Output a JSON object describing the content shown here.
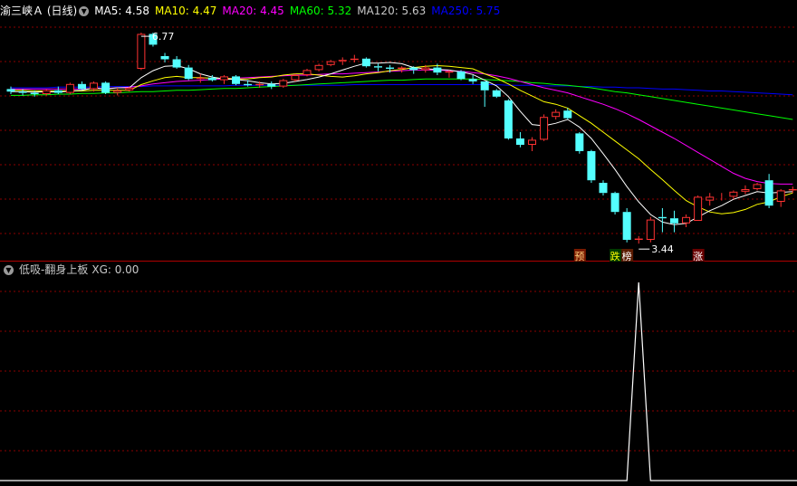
{
  "main_panel": {
    "title": "渝三峡Ａ (日线)",
    "ma_labels": [
      {
        "text": "MA5: 4.58",
        "color": "#ffffff"
      },
      {
        "text": "MA10: 4.47",
        "color": "#ffff00"
      },
      {
        "text": "MA20: 4.45",
        "color": "#ff00ff"
      },
      {
        "text": "MA60: 5.32",
        "color": "#00ff00"
      },
      {
        "text": "MA120: 5.63",
        "color": "#c8c8c8"
      },
      {
        "text": "MA250: 5.75",
        "color": "#0000ff"
      }
    ],
    "high_label": "6.77",
    "low_label": "3.44",
    "tags": [
      {
        "text": "预",
        "bg": "#7a1a00",
        "fg": "#ffd080",
        "bar": 48
      },
      {
        "text": "跌",
        "bg": "#003a00",
        "fg": "#ffff00",
        "bar": 51
      },
      {
        "text": "榜",
        "bg": "#5a1a00",
        "fg": "#ffffff",
        "bar": 52
      },
      {
        "text": "涨",
        "bg": "#6a0000",
        "fg": "#ffffff",
        "bar": 58
      }
    ]
  },
  "sub_panel": {
    "title": "低吸-翻身上板",
    "indicator_label": "XG: 0.00"
  },
  "colors": {
    "up": "#ff3232",
    "down": "#54ffff",
    "grid": "#8b0000",
    "ma5": "#ffffff",
    "ma10": "#ffff00",
    "ma20": "#ff00ff",
    "ma60": "#00ff00",
    "ma250": "#0000ff",
    "xg": "#ffffff"
  },
  "chart_data": [
    {
      "type": "candlestick",
      "ylim": [
        3.2,
        7.0
      ],
      "ohlc": [
        [
          5.88,
          5.92,
          5.8,
          5.84
        ],
        [
          5.84,
          5.88,
          5.78,
          5.82
        ],
        [
          5.82,
          5.86,
          5.76,
          5.8
        ],
        [
          5.8,
          5.88,
          5.78,
          5.86
        ],
        [
          5.86,
          5.92,
          5.8,
          5.82
        ],
        [
          5.82,
          5.98,
          5.8,
          5.96
        ],
        [
          5.96,
          6.0,
          5.86,
          5.88
        ],
        [
          5.88,
          6.0,
          5.84,
          5.98
        ],
        [
          5.98,
          6.0,
          5.8,
          5.82
        ],
        [
          5.82,
          5.9,
          5.78,
          5.86
        ],
        [
          5.86,
          5.92,
          5.84,
          5.9
        ],
        [
          6.2,
          6.77,
          6.18,
          6.75
        ],
        [
          6.75,
          6.77,
          6.55,
          6.58
        ],
        [
          6.4,
          6.45,
          6.3,
          6.35
        ],
        [
          6.35,
          6.4,
          6.2,
          6.22
        ],
        [
          6.22,
          6.26,
          6.02,
          6.04
        ],
        [
          6.04,
          6.12,
          5.98,
          6.06
        ],
        [
          6.06,
          6.1,
          6.0,
          6.02
        ],
        [
          6.02,
          6.1,
          5.96,
          6.08
        ],
        [
          6.08,
          6.1,
          5.94,
          5.96
        ],
        [
          5.96,
          6.02,
          5.92,
          5.94
        ],
        [
          5.94,
          6.0,
          5.9,
          5.96
        ],
        [
          5.96,
          6.0,
          5.88,
          5.92
        ],
        [
          5.92,
          6.04,
          5.9,
          6.02
        ],
        [
          6.02,
          6.12,
          6.0,
          6.1
        ],
        [
          6.1,
          6.2,
          6.08,
          6.18
        ],
        [
          6.18,
          6.28,
          6.16,
          6.26
        ],
        [
          6.26,
          6.34,
          6.24,
          6.32
        ],
        [
          6.32,
          6.38,
          6.26,
          6.34
        ],
        [
          6.34,
          6.42,
          6.3,
          6.36
        ],
        [
          6.36,
          6.38,
          6.22,
          6.24
        ],
        [
          6.24,
          6.28,
          6.16,
          6.22
        ],
        [
          6.22,
          6.26,
          6.14,
          6.2
        ],
        [
          6.2,
          6.24,
          6.14,
          6.22
        ],
        [
          6.22,
          6.24,
          6.12,
          6.18
        ],
        [
          6.18,
          6.26,
          6.14,
          6.22
        ],
        [
          6.22,
          6.28,
          6.1,
          6.14
        ],
        [
          6.14,
          6.18,
          6.06,
          6.16
        ],
        [
          6.16,
          6.18,
          6.02,
          6.04
        ],
        [
          6.04,
          6.1,
          5.96,
          6.0
        ],
        [
          6.0,
          6.0,
          5.6,
          5.86
        ],
        [
          5.86,
          5.88,
          5.74,
          5.76
        ],
        [
          5.7,
          5.72,
          5.08,
          5.1
        ],
        [
          5.1,
          5.2,
          4.96,
          5.0
        ],
        [
          5.0,
          5.12,
          4.9,
          5.08
        ],
        [
          5.08,
          5.48,
          5.06,
          5.44
        ],
        [
          5.44,
          5.56,
          5.4,
          5.52
        ],
        [
          5.54,
          5.58,
          5.4,
          5.42
        ],
        [
          5.18,
          5.2,
          4.86,
          4.9
        ],
        [
          4.9,
          4.92,
          4.4,
          4.44
        ],
        [
          4.4,
          4.44,
          4.2,
          4.24
        ],
        [
          4.24,
          4.26,
          3.9,
          3.94
        ],
        [
          3.94,
          4.0,
          3.46,
          3.5
        ],
        [
          3.5,
          3.56,
          3.44,
          3.52
        ],
        [
          3.5,
          3.86,
          3.46,
          3.82
        ],
        [
          3.86,
          4.0,
          3.62,
          3.84
        ],
        [
          3.84,
          3.96,
          3.62,
          3.76
        ],
        [
          3.76,
          3.9,
          3.7,
          3.86
        ],
        [
          3.8,
          4.2,
          3.8,
          4.18
        ],
        [
          4.12,
          4.24,
          4.04,
          4.18
        ],
        [
          4.18,
          4.24,
          4.12,
          4.18
        ],
        [
          4.18,
          4.28,
          4.14,
          4.26
        ],
        [
          4.26,
          4.36,
          4.22,
          4.3
        ],
        [
          4.3,
          4.4,
          4.28,
          4.38
        ],
        [
          4.44,
          4.54,
          4.0,
          4.04
        ],
        [
          4.1,
          4.3,
          4.02,
          4.28
        ],
        [
          4.28,
          4.34,
          4.24,
          4.3
        ]
      ],
      "ma5": [
        5.84,
        5.84,
        5.83,
        5.84,
        5.83,
        5.85,
        5.86,
        5.9,
        5.88,
        5.9,
        5.9,
        6.06,
        6.17,
        6.24,
        6.25,
        6.2,
        6.12,
        6.07,
        6.04,
        6.03,
        6.01,
        5.98,
        5.96,
        5.97,
        6.0,
        6.03,
        6.07,
        6.12,
        6.18,
        6.24,
        6.29,
        6.29,
        6.3,
        6.28,
        6.22,
        6.2,
        6.19,
        6.18,
        6.15,
        6.11,
        6.02,
        5.93,
        5.76,
        5.53,
        5.32,
        5.3,
        5.34,
        5.4,
        5.28,
        5.1,
        4.86,
        4.61,
        4.34,
        4.1,
        3.9,
        3.78,
        3.74,
        3.76,
        3.86,
        3.96,
        4.04,
        4.14,
        4.2,
        4.26,
        4.24,
        4.25,
        4.26
      ],
      "ma10": [
        5.86,
        5.86,
        5.85,
        5.85,
        5.85,
        5.85,
        5.85,
        5.86,
        5.86,
        5.86,
        5.86,
        5.95,
        6.01,
        6.06,
        6.08,
        6.06,
        6.06,
        6.05,
        6.05,
        6.04,
        6.04,
        6.06,
        6.07,
        6.1,
        6.12,
        6.12,
        6.1,
        6.08,
        6.07,
        6.09,
        6.12,
        6.14,
        6.17,
        6.19,
        6.22,
        6.24,
        6.25,
        6.24,
        6.22,
        6.2,
        6.12,
        6.05,
        5.96,
        5.86,
        5.77,
        5.68,
        5.64,
        5.58,
        5.46,
        5.34,
        5.2,
        5.06,
        4.92,
        4.78,
        4.61,
        4.45,
        4.28,
        4.12,
        4.02,
        3.94,
        3.91,
        3.93,
        3.98,
        4.06,
        4.1,
        4.18,
        4.24
      ],
      "ma20": [
        5.88,
        5.88,
        5.88,
        5.88,
        5.88,
        5.88,
        5.88,
        5.89,
        5.89,
        5.9,
        5.91,
        5.93,
        5.96,
        5.98,
        6.0,
        6.01,
        6.02,
        6.03,
        6.04,
        6.05,
        6.06,
        6.07,
        6.08,
        6.09,
        6.1,
        6.1,
        6.11,
        6.12,
        6.12,
        6.13,
        6.14,
        6.15,
        6.16,
        6.17,
        6.18,
        6.18,
        6.18,
        6.17,
        6.16,
        6.14,
        6.12,
        6.09,
        6.05,
        6.0,
        5.95,
        5.9,
        5.86,
        5.82,
        5.76,
        5.7,
        5.64,
        5.57,
        5.49,
        5.4,
        5.3,
        5.2,
        5.1,
        4.99,
        4.88,
        4.77,
        4.66,
        4.55,
        4.47,
        4.42,
        4.39,
        4.38,
        4.38
      ],
      "ma60": [
        5.78,
        5.78,
        5.79,
        5.79,
        5.8,
        5.8,
        5.81,
        5.81,
        5.82,
        5.82,
        5.83,
        5.84,
        5.84,
        5.85,
        5.86,
        5.86,
        5.87,
        5.88,
        5.89,
        5.89,
        5.9,
        5.91,
        5.92,
        5.93,
        5.94,
        5.95,
        5.96,
        5.97,
        5.98,
        5.99,
        6.0,
        6.01,
        6.02,
        6.02,
        6.03,
        6.04,
        6.04,
        6.04,
        6.04,
        6.04,
        6.03,
        6.02,
        6.01,
        6.0,
        5.98,
        5.97,
        5.95,
        5.94,
        5.92,
        5.9,
        5.87,
        5.84,
        5.82,
        5.79,
        5.76,
        5.73,
        5.7,
        5.67,
        5.64,
        5.61,
        5.58,
        5.55,
        5.52,
        5.49,
        5.46,
        5.43,
        5.4
      ],
      "ma250": [
        5.9,
        5.9,
        5.9,
        5.9,
        5.91,
        5.91,
        5.91,
        5.91,
        5.92,
        5.92,
        5.92,
        5.92,
        5.93,
        5.93,
        5.93,
        5.93,
        5.93,
        5.93,
        5.93,
        5.94,
        5.94,
        5.94,
        5.94,
        5.94,
        5.94,
        5.94,
        5.94,
        5.94,
        5.94,
        5.95,
        5.95,
        5.95,
        5.95,
        5.95,
        5.95,
        5.95,
        5.95,
        5.95,
        5.95,
        5.95,
        5.95,
        5.95,
        5.94,
        5.94,
        5.94,
        5.93,
        5.93,
        5.93,
        5.92,
        5.92,
        5.91,
        5.91,
        5.9,
        5.9,
        5.89,
        5.88,
        5.88,
        5.87,
        5.86,
        5.85,
        5.85,
        5.84,
        5.83,
        5.82,
        5.81,
        5.8,
        5.79
      ]
    },
    {
      "type": "line",
      "series": [
        {
          "name": "XG",
          "values": [
            0,
            0,
            0,
            0,
            0,
            0,
            0,
            0,
            0,
            0,
            0,
            0,
            0,
            0,
            0,
            0,
            0,
            0,
            0,
            0,
            0,
            0,
            0,
            0,
            0,
            0,
            0,
            0,
            0,
            0,
            0,
            0,
            0,
            0,
            0,
            0,
            0,
            0,
            0,
            0,
            0,
            0,
            0,
            0,
            0,
            0,
            0,
            0,
            0,
            0,
            0,
            0,
            0,
            1,
            0,
            0,
            0,
            0,
            0,
            0,
            0,
            0,
            0,
            0,
            0,
            0,
            0
          ]
        }
      ],
      "ylim": [
        0,
        1
      ]
    }
  ]
}
